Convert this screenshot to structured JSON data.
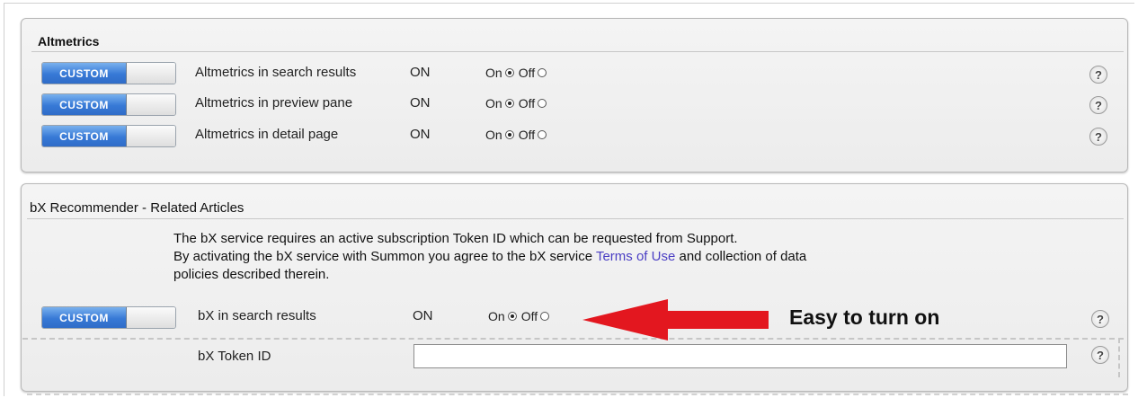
{
  "altmetrics": {
    "title": "Altmetrics",
    "rows": [
      {
        "toggle": "CUSTOM",
        "label": "Altmetrics in search results",
        "state": "ON",
        "on_label": "On",
        "off_label": "Off",
        "selected": "On",
        "help": "?"
      },
      {
        "toggle": "CUSTOM",
        "label": "Altmetrics in preview pane",
        "state": "ON",
        "on_label": "On",
        "off_label": "Off",
        "selected": "On",
        "help": "?"
      },
      {
        "toggle": "CUSTOM",
        "label": "Altmetrics in detail page",
        "state": "ON",
        "on_label": "On",
        "off_label": "Off",
        "selected": "On",
        "help": "?"
      }
    ]
  },
  "bx": {
    "title": "bX Recommender - Related Articles",
    "info_line1": "The bX service requires an active subscription Token ID which can be requested from Support.",
    "info_line2_pre": "By activating the bX service with Summon you agree to the bX service ",
    "info_link": "Terms of Use",
    "info_line2_post": " and collection of data",
    "info_line3": "policies described therein.",
    "row": {
      "toggle": "CUSTOM",
      "label": "bX  in search results",
      "state": "ON",
      "on_label": "On",
      "off_label": "Off",
      "selected": "On",
      "help": "?"
    },
    "token": {
      "label": "bX Token ID",
      "value": "",
      "help": "?"
    }
  },
  "annotation": {
    "text": "Easy to turn on",
    "arrow_color": "#e3171f"
  }
}
